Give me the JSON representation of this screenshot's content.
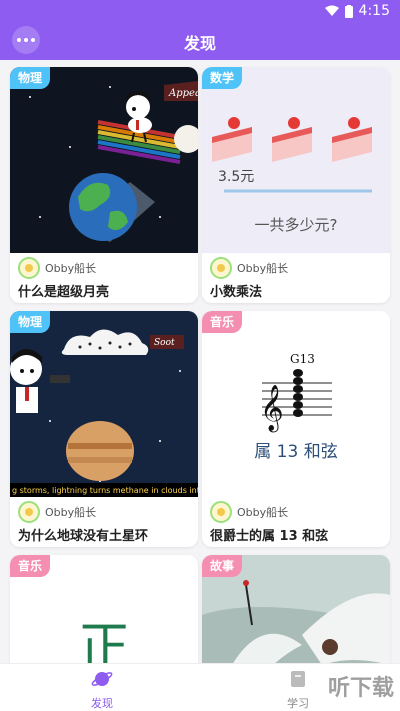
{
  "status": {
    "time": "4:15"
  },
  "appbar": {
    "title": "发现"
  },
  "cards": [
    {
      "tag": "物理",
      "tag_color": "#4fc3f7",
      "author": "Obby船长",
      "title": "什么是超级月亮",
      "sign": "Appear"
    },
    {
      "tag": "数学",
      "tag_color": "#4fc3f7",
      "author": "Obby船长",
      "title": "小数乘法",
      "price": "3.5元",
      "question": "一共多少元?"
    },
    {
      "tag": "物理",
      "tag_color": "#4fc3f7",
      "author": "Obby船长",
      "title": "为什么地球没有土星环",
      "sign": "Soot",
      "caption": "g storms, lightning turns methane in clouds into"
    },
    {
      "tag": "音乐",
      "tag_color": "#f48fb1",
      "author": "Obby船长",
      "title": "很爵士的属 13 和弦",
      "chord": "G13",
      "chord_name": "属 13 和弦"
    },
    {
      "tag": "音乐",
      "tag_color": "#f48fb1",
      "glyph": "正"
    },
    {
      "tag": "故事",
      "tag_color": "#f48fb1"
    }
  ],
  "nav": {
    "discover": "发现",
    "study": "学习"
  },
  "watermark": "听下载",
  "colors": {
    "primary": "#8e5cf0"
  }
}
